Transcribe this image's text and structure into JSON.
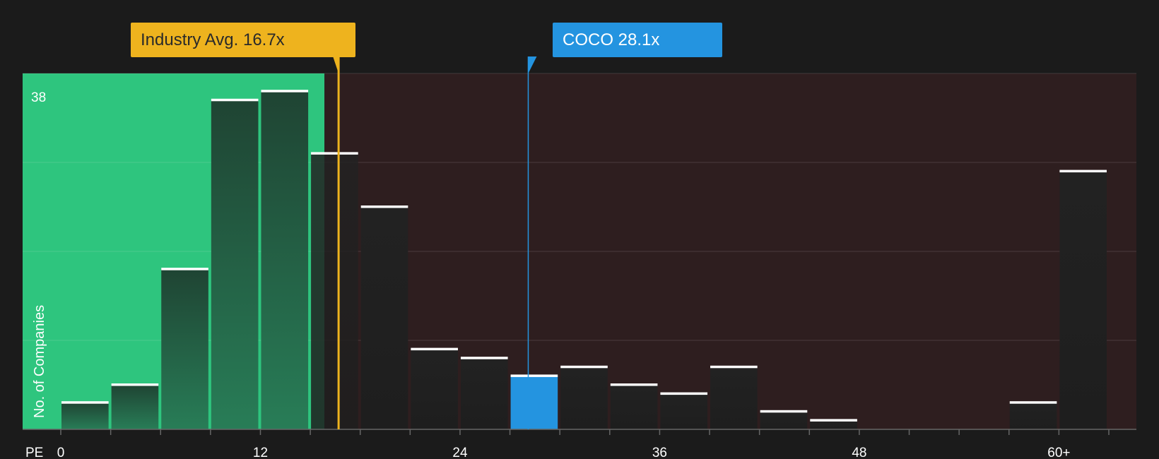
{
  "chart_data": {
    "type": "bar",
    "xlabel": "PE",
    "ylabel": "No. of Companies",
    "x_tick_labels": [
      "0",
      "12",
      "24",
      "36",
      "48",
      "60+"
    ],
    "x_tick_values": [
      0,
      12,
      24,
      36,
      48,
      60
    ],
    "y_max_label": "38",
    "y_range": [
      0,
      40
    ],
    "bin_width": 3,
    "bins": [
      {
        "x": 0,
        "value": 3
      },
      {
        "x": 3,
        "value": 5
      },
      {
        "x": 6,
        "value": 18
      },
      {
        "x": 9,
        "value": 37
      },
      {
        "x": 12,
        "value": 38
      },
      {
        "x": 15,
        "value": 31
      },
      {
        "x": 18,
        "value": 25
      },
      {
        "x": 21,
        "value": 9
      },
      {
        "x": 24,
        "value": 8
      },
      {
        "x": 27,
        "value": 6,
        "highlight": true
      },
      {
        "x": 30,
        "value": 7
      },
      {
        "x": 33,
        "value": 5
      },
      {
        "x": 36,
        "value": 4
      },
      {
        "x": 39,
        "value": 7
      },
      {
        "x": 42,
        "value": 2
      },
      {
        "x": 45,
        "value": 1
      },
      {
        "x": 48,
        "value": 0
      },
      {
        "x": 51,
        "value": 0
      },
      {
        "x": 54,
        "value": 0
      },
      {
        "x": 57,
        "value": 3
      },
      {
        "x": 60,
        "value": 29
      }
    ],
    "industry_avg": {
      "label": "Industry Avg. 16.7x",
      "value": 16.7
    },
    "company": {
      "label": "COCO 28.1x",
      "value": 28.1
    },
    "colors": {
      "background": "#1b1b1b",
      "below_avg_zone": "#2ec57e",
      "above_avg_zone": "#2e1e1f",
      "industry_avg": "#eeb31e",
      "company": "#2494e0",
      "bar_cap": "#ffffff"
    }
  }
}
